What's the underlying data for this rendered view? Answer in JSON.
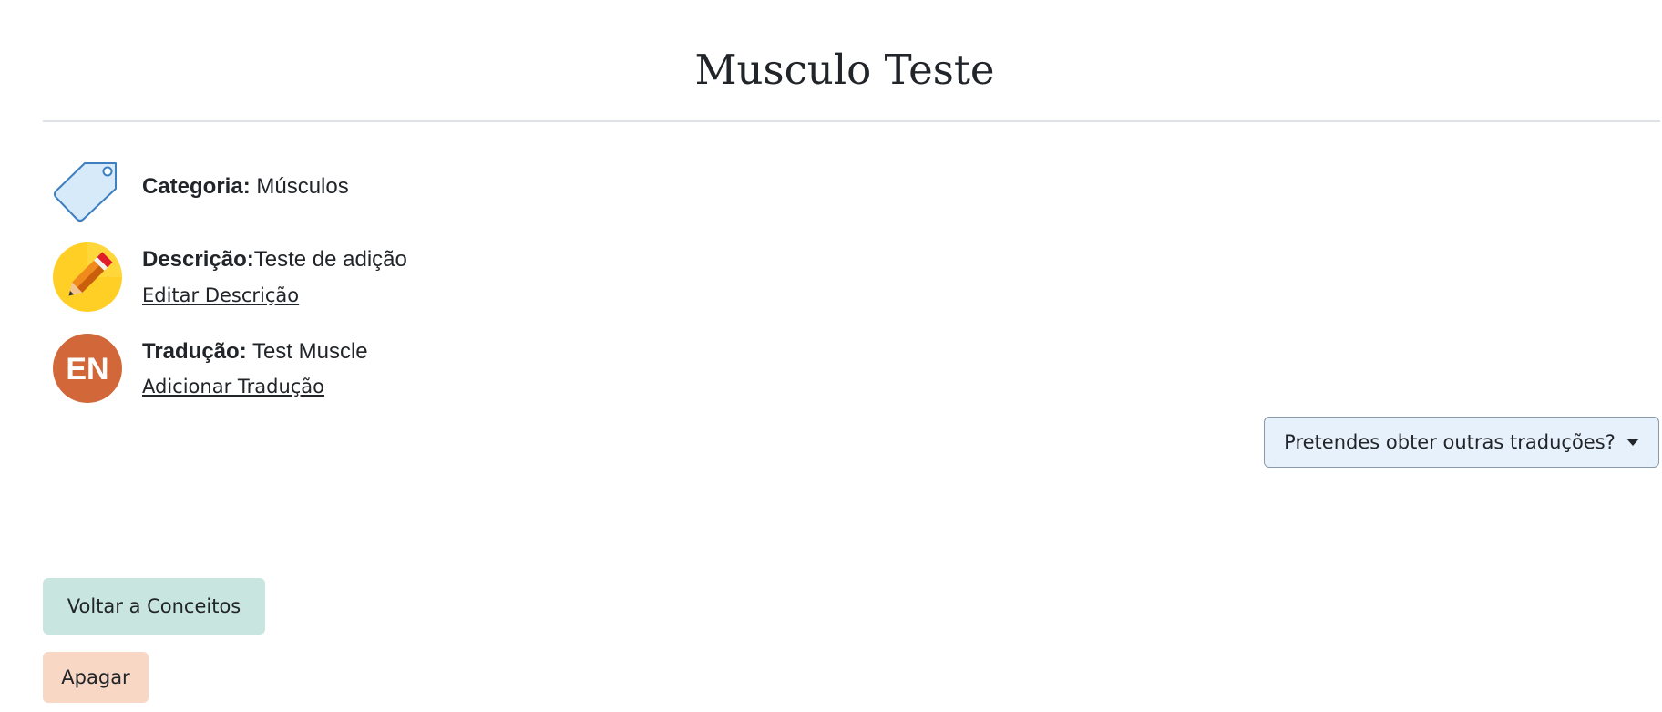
{
  "page": {
    "title": "Musculo Teste"
  },
  "details": {
    "category": {
      "label": "Categoria:",
      "value": " Músculos",
      "icon": "tag-icon"
    },
    "description": {
      "label": "Descrição:",
      "value": "Teste de adição",
      "link": "Editar Descrição",
      "icon": "pencil-icon"
    },
    "translation": {
      "label": "Tradução:",
      "value": " Test Muscle",
      "link": "Adicionar Tradução",
      "icon": "language-en-icon",
      "badge_text": "EN"
    }
  },
  "translations_dropdown": {
    "label": "Pretendes obter outras traduções?"
  },
  "actions": {
    "back_label": "Voltar a Conceitos",
    "delete_label": "Apagar"
  },
  "colors": {
    "back_button_bg": "#c9e5df",
    "delete_button_bg": "#f8d8c5",
    "dropdown_bg": "#e7f1fc",
    "en_badge": "#d2683a",
    "pencil_circle": "#ffcf26"
  }
}
